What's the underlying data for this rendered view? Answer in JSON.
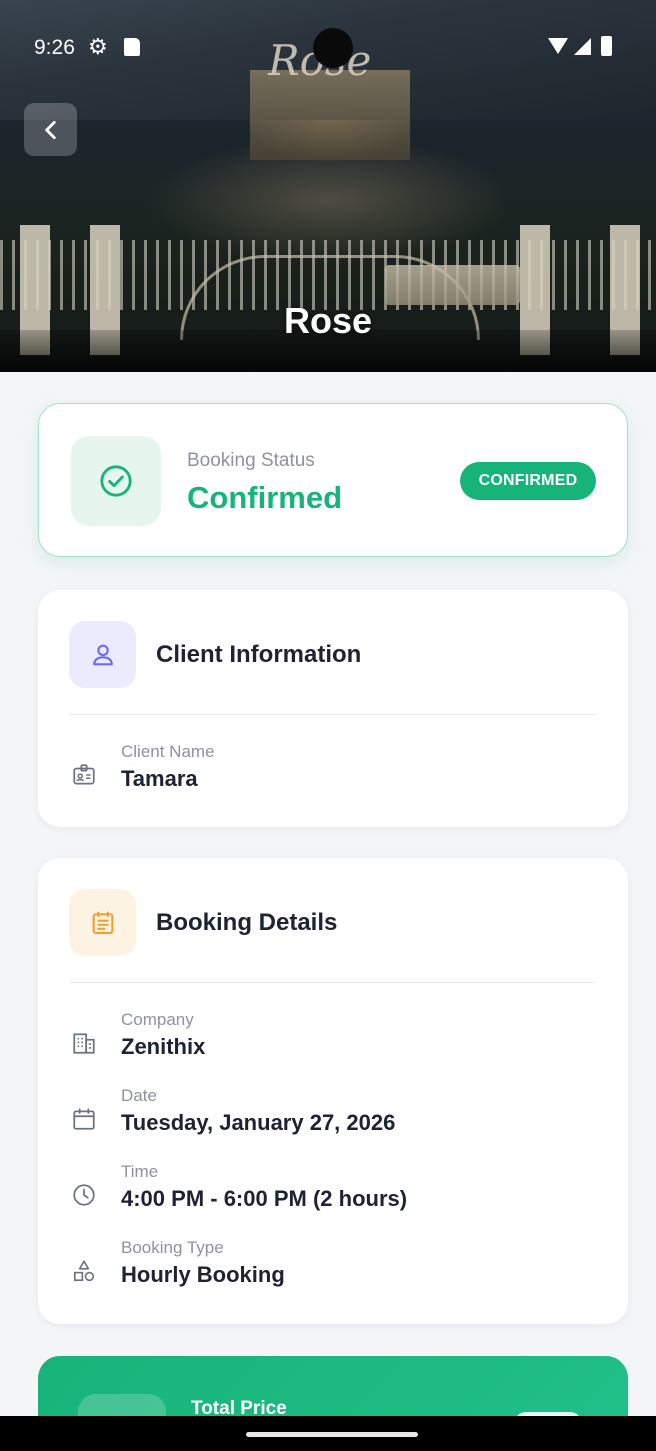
{
  "status_bar": {
    "time": "9:26",
    "icons": [
      "gear-icon",
      "sd-card-icon",
      "wifi-icon",
      "signal-icon",
      "battery-icon"
    ]
  },
  "hero": {
    "title": "Rose"
  },
  "booking_status": {
    "label": "Booking Status",
    "value": "Confirmed",
    "badge": "CONFIRMED",
    "accent": "#17b47a"
  },
  "client_information": {
    "title": "Client Information",
    "icon_color": "#6e6af0",
    "icon_bg": "#ecebfd",
    "fields": [
      {
        "icon": "id-badge-icon",
        "label": "Client Name",
        "value": "Tamara"
      }
    ]
  },
  "booking_details": {
    "title": "Booking Details",
    "icon_color": "#f0a030",
    "icon_bg": "#fdf3e2",
    "fields": [
      {
        "icon": "building-icon",
        "label": "Company",
        "value": "Zenithix"
      },
      {
        "icon": "calendar-icon",
        "label": "Date",
        "value": "Tuesday, January 27, 2026"
      },
      {
        "icon": "clock-icon",
        "label": "Time",
        "value": "4:00 PM - 6:00 PM (2 hours)"
      },
      {
        "icon": "shapes-icon",
        "label": "Booking Type",
        "value": "Hourly Booking"
      }
    ]
  },
  "total_price": {
    "label": "Total Price"
  }
}
